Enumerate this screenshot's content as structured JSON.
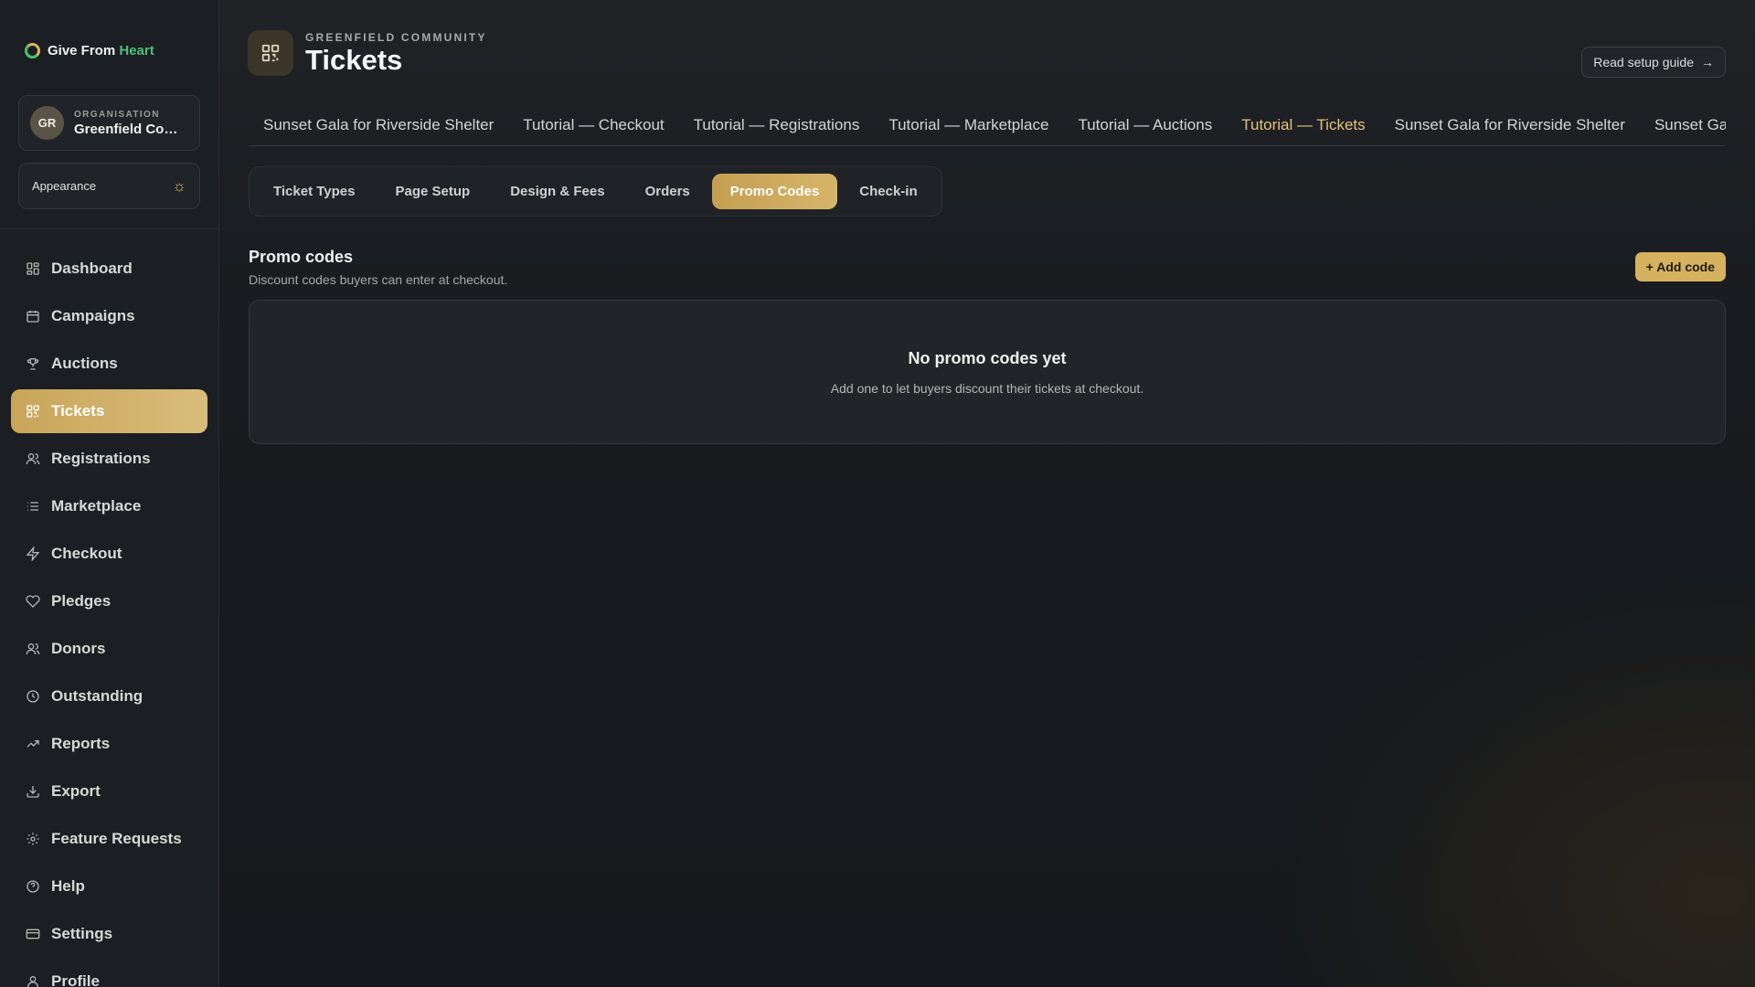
{
  "brand": {
    "name_prefix": "Give From",
    "name_accent": "Heart"
  },
  "org": {
    "avatar": "GR",
    "label": "ORGANISATION",
    "name": "Greenfield Community"
  },
  "appearance": {
    "label": "Appearance",
    "icon": "sun-icon"
  },
  "sidebar": {
    "items": [
      {
        "label": "Dashboard",
        "icon": "grid-icon"
      },
      {
        "label": "Campaigns",
        "icon": "calendar-icon"
      },
      {
        "label": "Auctions",
        "icon": "trophy-icon"
      },
      {
        "label": "Tickets",
        "icon": "ticket-grid-icon",
        "active": true
      },
      {
        "label": "Registrations",
        "icon": "users-icon"
      },
      {
        "label": "Marketplace",
        "icon": "list-icon"
      },
      {
        "label": "Checkout",
        "icon": "lightning-icon"
      },
      {
        "label": "Pledges",
        "icon": "heart-icon"
      },
      {
        "label": "Donors",
        "icon": "people-icon"
      },
      {
        "label": "Outstanding",
        "icon": "clock-icon"
      },
      {
        "label": "Reports",
        "icon": "trend-icon"
      },
      {
        "label": "Export",
        "icon": "download-icon"
      },
      {
        "label": "Feature Requests",
        "icon": "sparkle-icon"
      },
      {
        "label": "Help",
        "icon": "help-icon"
      },
      {
        "label": "Settings",
        "icon": "card-icon"
      },
      {
        "label": "Profile",
        "icon": "user-icon"
      }
    ]
  },
  "header": {
    "eyebrow": "GREENFIELD COMMUNITY",
    "title": "Tickets",
    "guide_button": "Read setup guide"
  },
  "event_tabs": [
    {
      "label": "Sunset Gala for Riverside Shelter"
    },
    {
      "label": "Tutorial — Checkout"
    },
    {
      "label": "Tutorial — Registrations"
    },
    {
      "label": "Tutorial — Marketplace"
    },
    {
      "label": "Tutorial — Auctions"
    },
    {
      "label": "Tutorial — Tickets",
      "active": true
    },
    {
      "label": "Sunset Gala for Riverside Shelter"
    },
    {
      "label": "Sunset Gala for Riverside Shelter"
    }
  ],
  "sub_tabs": [
    {
      "label": "Ticket Types"
    },
    {
      "label": "Page Setup"
    },
    {
      "label": "Design & Fees"
    },
    {
      "label": "Orders"
    },
    {
      "label": "Promo Codes",
      "active": true
    },
    {
      "label": "Check-in"
    }
  ],
  "promo": {
    "title": "Promo codes",
    "subtitle": "Discount codes buyers can enter at checkout.",
    "add_button": "+ Add code",
    "empty_title": "No promo codes yet",
    "empty_subtitle": "Add one to let buyers discount their tickets at checkout."
  },
  "colors": {
    "accent": "#d6b25e",
    "brand_green": "#4cc07a",
    "background": "#15181c"
  }
}
